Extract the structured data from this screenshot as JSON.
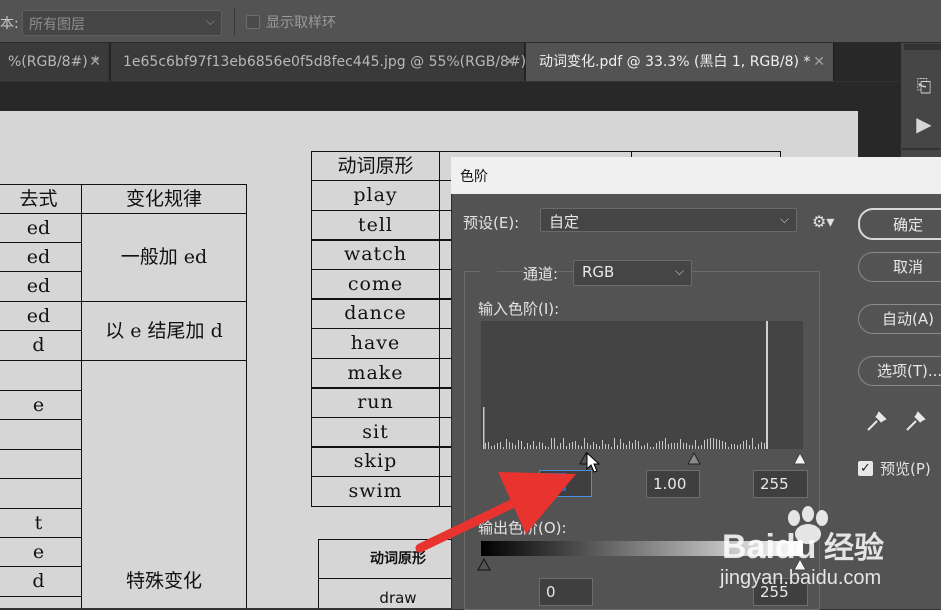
{
  "options_bar": {
    "partial_label": "本:",
    "layers_select": "所有图层",
    "show_ring_label": "显示取样环"
  },
  "tabs": [
    {
      "label": "%(RGB/8#) *",
      "active": false
    },
    {
      "label": "1e65c6bf97f13eb6856e0f5d8fec445.jpg @ 55%(RGB/8#)",
      "active": false
    },
    {
      "label": "动词变化.pdf @ 33.3% (黑白 1, RGB/8) *",
      "active": true
    }
  ],
  "document": {
    "left_table": {
      "header_past": "去式",
      "header_rule": "变化规律",
      "past_cells": [
        "ed",
        "ed",
        "ed",
        "ed",
        "d",
        "",
        "e",
        "",
        "",
        "",
        "t",
        "e",
        "d"
      ],
      "rule_general": "一般加 ed",
      "rule_e_end": "以 e 结尾加 d",
      "rule_special": "特殊变化"
    },
    "verb_table": {
      "header": "动词原形",
      "verbs": [
        "play",
        "tell",
        "watch",
        "come",
        "dance",
        "have",
        "make",
        "run",
        "sit",
        "skip",
        "swim"
      ]
    },
    "small_table": {
      "header": "动词原形",
      "first_row": "draw"
    }
  },
  "levels_dialog": {
    "title": "色阶",
    "preset_label": "预设(E):",
    "preset_value": "自定",
    "channel_label": "通道:",
    "channel_value": "RGB",
    "input_levels_label": "输入色阶(I):",
    "input_black": "82",
    "input_gamma": "1.00",
    "input_white": "255",
    "output_levels_label": "输出色阶(O):",
    "output_black": "0",
    "output_white": "255",
    "buttons": {
      "ok": "确定",
      "cancel": "取消",
      "auto": "自动(A)",
      "options": "选项(T)..."
    },
    "preview_label": "预览(P)",
    "preview_checked": true
  },
  "watermark": {
    "brand": "Baidu",
    "brand_cn": "经验",
    "url": "jingyan.baidu.com"
  },
  "colors": {
    "annotation_arrow": "#e8332f",
    "selection_highlight": "#1a6fd6"
  },
  "icons": [
    "gear-icon",
    "eyedropper-icon",
    "history-icon",
    "play-icon",
    "close-icon",
    "chevron-down-icon"
  ]
}
